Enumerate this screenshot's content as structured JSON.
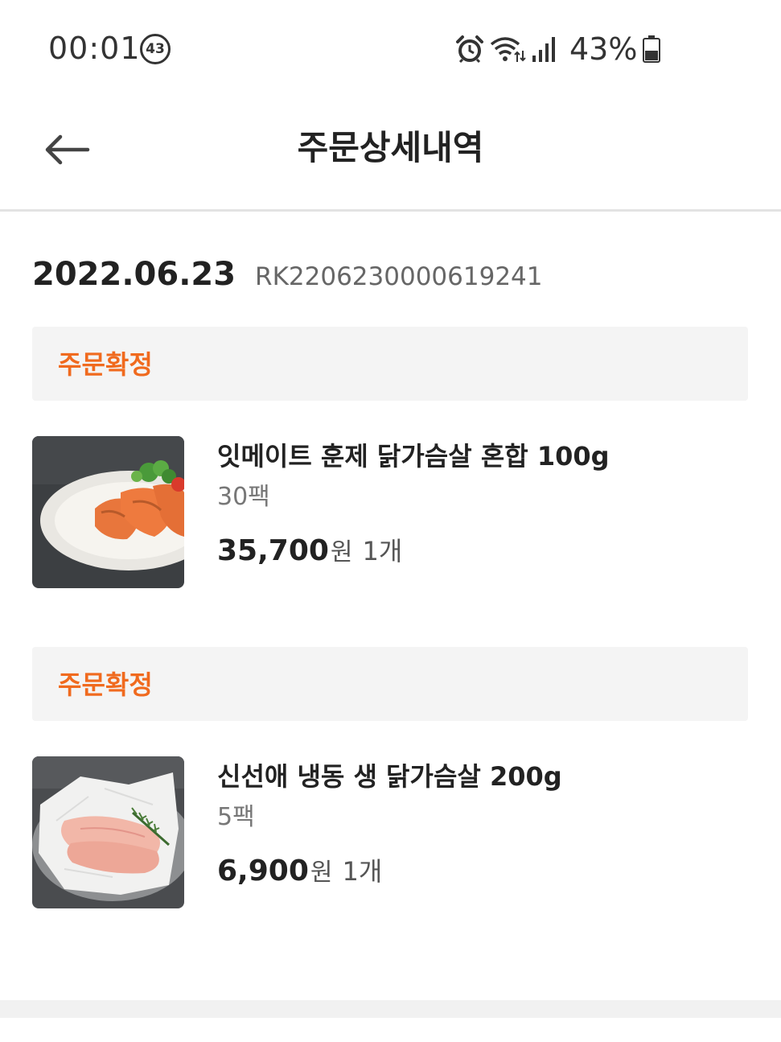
{
  "status_bar": {
    "time": "00:01",
    "notification_count": "43",
    "battery_percent": "43%",
    "icons": [
      "alarm-icon",
      "wifi-icon",
      "signal-icon",
      "battery-icon"
    ]
  },
  "header": {
    "title": "주문상세내역",
    "back_icon": "arrow-left-icon"
  },
  "order": {
    "date": "2022.06.23",
    "number": "RK2206230000619241"
  },
  "items": [
    {
      "status": "주문확정",
      "name": "잇메이트 훈제 닭가슴살 혼합 100g",
      "option": "30팩",
      "price": "35,700",
      "currency": "원",
      "quantity": "1개",
      "image": "smoked-chicken-breast-image"
    },
    {
      "status": "주문확정",
      "name": "신선애 냉동 생 닭가슴살 200g",
      "option": "5팩",
      "price": "6,900",
      "currency": "원",
      "quantity": "1개",
      "image": "raw-chicken-breast-image"
    }
  ],
  "colors": {
    "accent": "#f06a1e",
    "status_box_bg": "#f4f4f4",
    "divider": "#e3e3e3"
  }
}
